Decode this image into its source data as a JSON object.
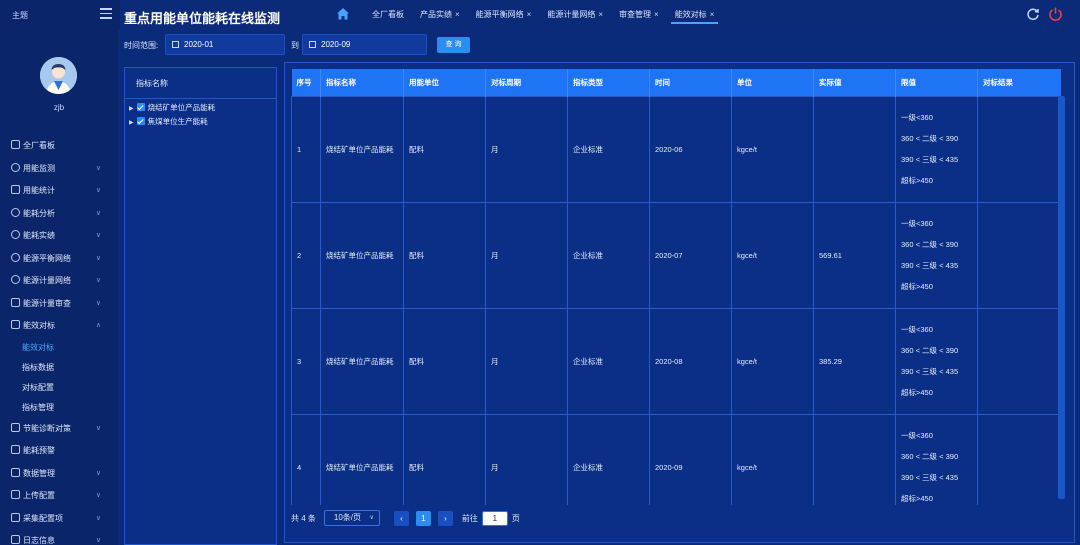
{
  "header": {
    "theme_label": "主题",
    "app_title": "重点用能单位能耗在线监测",
    "tabs": [
      {
        "label": "全厂看板",
        "closable": false
      },
      {
        "label": "产品实绩",
        "closable": true
      },
      {
        "label": "能源平衡网络",
        "closable": true
      },
      {
        "label": "能源计量网络",
        "closable": true
      },
      {
        "label": "审查管理",
        "closable": true
      },
      {
        "label": "能效对标",
        "closable": true
      }
    ],
    "close_glyph": "×"
  },
  "sidebar": {
    "username": "zjb",
    "items": [
      {
        "label": "全厂看板"
      },
      {
        "label": "用能监测"
      },
      {
        "label": "用能统计"
      },
      {
        "label": "能耗分析"
      },
      {
        "label": "能耗实绩"
      },
      {
        "label": "能源平衡网络"
      },
      {
        "label": "能源计量网络"
      },
      {
        "label": "能源计量审查"
      },
      {
        "label": "能效对标"
      },
      {
        "label": "节能诊断对策"
      },
      {
        "label": "能耗预警"
      },
      {
        "label": "数据管理"
      },
      {
        "label": "上传配置"
      },
      {
        "label": "采集配置项"
      },
      {
        "label": "日志信息"
      }
    ],
    "sub_items": [
      {
        "label": "能效对标"
      },
      {
        "label": "指标数据"
      },
      {
        "label": "对标配置"
      },
      {
        "label": "指标管理"
      }
    ]
  },
  "filter": {
    "range_label": "时间范围:",
    "start": "2020-01",
    "to_label": "到",
    "end": "2020-09",
    "query_label": "查 询"
  },
  "tree": {
    "header": "指标名称",
    "nodes": [
      {
        "label": "烧结矿单位产品能耗"
      },
      {
        "label": "焦煤单位生产能耗"
      }
    ]
  },
  "table": {
    "columns": [
      "序号",
      "指标名称",
      "用能单位",
      "对标周期",
      "指标类型",
      "时间",
      "单位",
      "实际值",
      "限值",
      "对标结果"
    ],
    "rows": [
      {
        "no": "1",
        "name": "烧结矿单位产品能耗",
        "unit_org": "配料",
        "period": "月",
        "type": "企业标准",
        "time": "2020-06",
        "unit": "kgce/t",
        "actual": "",
        "result": ""
      },
      {
        "no": "2",
        "name": "烧结矿单位产品能耗",
        "unit_org": "配料",
        "period": "月",
        "type": "企业标准",
        "time": "2020-07",
        "unit": "kgce/t",
        "actual": "569.61",
        "result": ""
      },
      {
        "no": "3",
        "name": "烧结矿单位产品能耗",
        "unit_org": "配料",
        "period": "月",
        "type": "企业标准",
        "time": "2020-08",
        "unit": "kgce/t",
        "actual": "385.29",
        "result": ""
      },
      {
        "no": "4",
        "name": "烧结矿单位产品能耗",
        "unit_org": "配料",
        "period": "月",
        "type": "企业标准",
        "time": "2020-09",
        "unit": "kgce/t",
        "actual": "",
        "result": ""
      }
    ],
    "limits": [
      "一级<360",
      "360 < 二级 < 390",
      "390 < 三级 < 435",
      "超标>450"
    ]
  },
  "pagination": {
    "total": "共 4 条",
    "page_size": "10条/页",
    "prev": "‹",
    "current": "1",
    "next": "›",
    "goto_label": "前往",
    "goto_value": "1",
    "page_suffix": "页"
  },
  "colors": {
    "accent": "#2d8cf0",
    "header_bg": "#1e74f5",
    "page_bg": "#0a2a7a",
    "danger": "#e8453c"
  }
}
